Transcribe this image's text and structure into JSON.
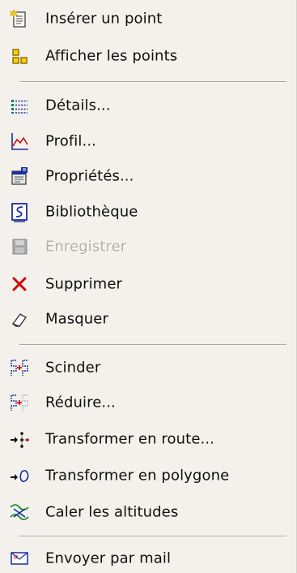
{
  "menu": {
    "items": [
      {
        "label": "Insérer un point",
        "icon": "insert-point-icon",
        "enabled": true
      },
      {
        "label": "Afficher les points",
        "icon": "show-points-icon",
        "enabled": true
      },
      {
        "label": "Détails...",
        "icon": "details-list-icon",
        "enabled": true
      },
      {
        "label": "Profil...",
        "icon": "profile-chart-icon",
        "enabled": true
      },
      {
        "label": "Propriétés...",
        "icon": "properties-icon",
        "enabled": true
      },
      {
        "label": "Bibliothèque",
        "icon": "library-icon",
        "enabled": true
      },
      {
        "label": "Enregistrer",
        "icon": "save-floppy-icon",
        "enabled": false
      },
      {
        "label": "Supprimer",
        "icon": "delete-x-icon",
        "enabled": true
      },
      {
        "label": "Masquer",
        "icon": "hide-eraser-icon",
        "enabled": true
      },
      {
        "label": "Scinder",
        "icon": "split-icon",
        "enabled": true
      },
      {
        "label": "Réduire...",
        "icon": "reduce-icon",
        "enabled": true
      },
      {
        "label": "Transformer en route...",
        "icon": "to-route-icon",
        "enabled": true
      },
      {
        "label": "Transformer en polygone",
        "icon": "to-polygon-icon",
        "enabled": true
      },
      {
        "label": "Caler les altitudes",
        "icon": "altitudes-icon",
        "enabled": true
      },
      {
        "label": "Envoyer par mail",
        "icon": "mail-envelope-icon",
        "enabled": true
      }
    ]
  },
  "colors": {
    "background": "#f4f1ec",
    "text": "#101010",
    "disabled_text": "#b3b0a9",
    "icon_blue": "#1b2f9b",
    "icon_red": "#d40000",
    "icon_yellow": "#e8c000",
    "icon_green": "#1b8f2b"
  }
}
